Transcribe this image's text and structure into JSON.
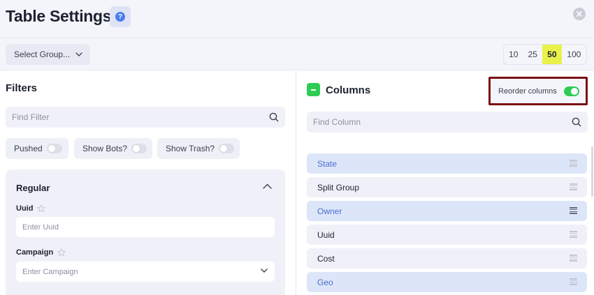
{
  "header": {
    "title": "Table Settings",
    "help_icon": "question-icon",
    "close_icon": "close-icon"
  },
  "toolbar": {
    "group_select_label": "Select Group...",
    "page_sizes": [
      "10",
      "25",
      "50",
      "100"
    ],
    "active_page_size": "50"
  },
  "filters": {
    "title": "Filters",
    "search_placeholder": "Find Filter",
    "toggles": [
      {
        "label": "Pushed",
        "on": false
      },
      {
        "label": "Show Bots?",
        "on": false
      },
      {
        "label": "Show Trash?",
        "on": false
      }
    ],
    "regular": {
      "title": "Regular",
      "fields": [
        {
          "label": "Uuid",
          "placeholder": "Enter Uuid",
          "type": "text"
        },
        {
          "label": "Campaign",
          "placeholder": "Enter Campaign",
          "type": "select"
        }
      ]
    }
  },
  "columns": {
    "title": "Columns",
    "reorder_label": "Reorder columns",
    "reorder_on": true,
    "search_placeholder": "Find Column",
    "items": [
      {
        "label": "State",
        "highlighted": true
      },
      {
        "label": "Split Group",
        "highlighted": false
      },
      {
        "label": "Owner",
        "highlighted": true
      },
      {
        "label": "Uuid",
        "highlighted": false
      },
      {
        "label": "Cost",
        "highlighted": false
      },
      {
        "label": "Geo",
        "highlighted": true
      }
    ]
  },
  "colors": {
    "accent_green": "#2ecc55",
    "active_page_size_bg": "#e8f24a",
    "highlight_row_bg": "#dde5f9",
    "highlight_row_text": "#4a6fd0",
    "reorder_outline": "#7a0f14",
    "help_blue": "#4a7df2"
  }
}
